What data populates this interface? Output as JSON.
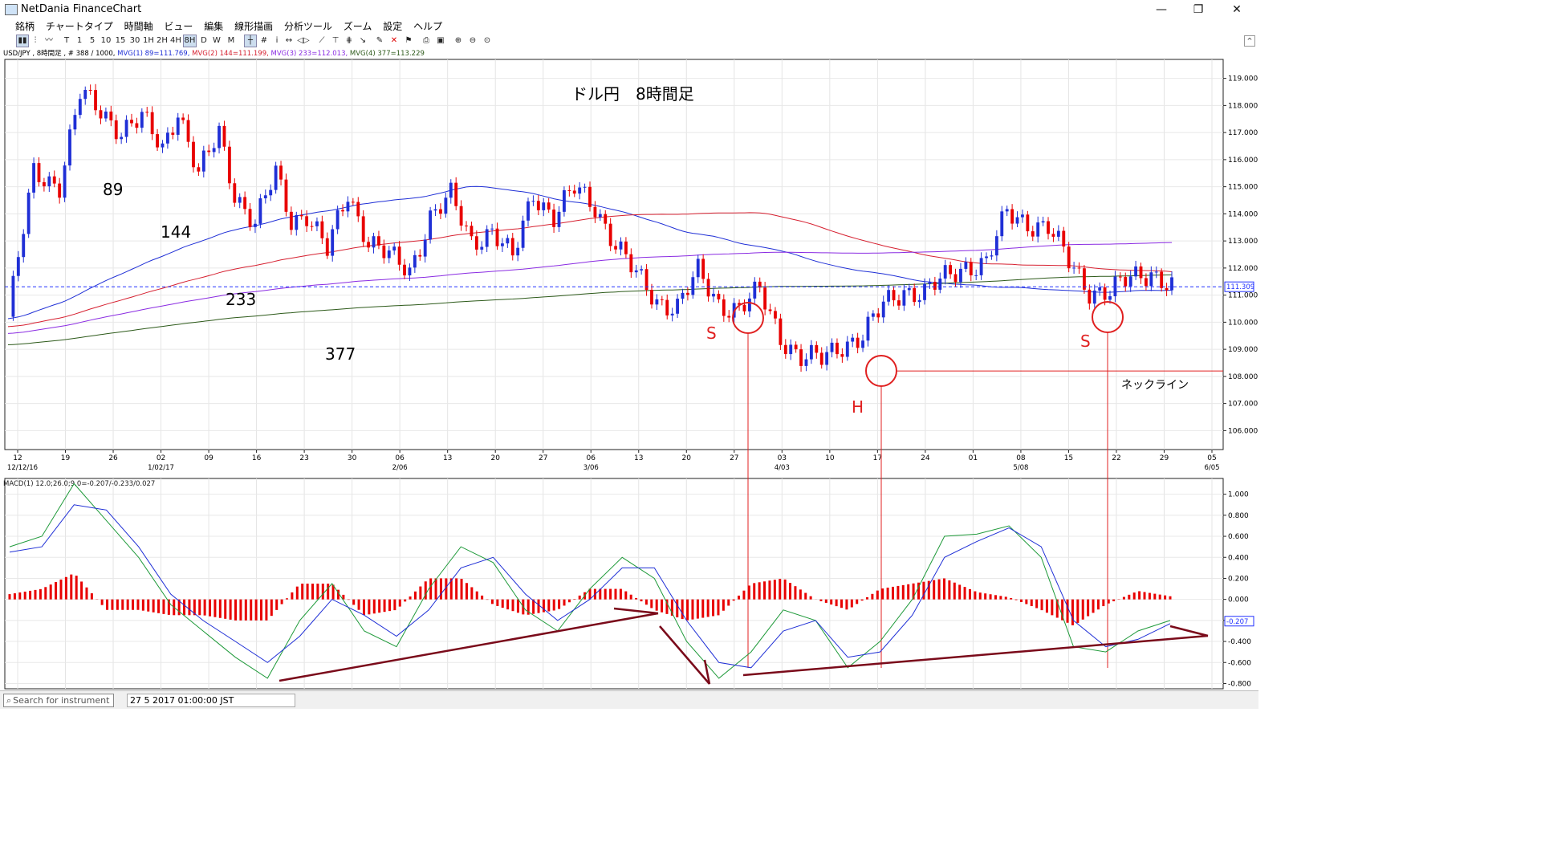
{
  "window": {
    "title": "NetDania FinanceChart",
    "minimize_glyph": "—",
    "maximize_glyph": "❐",
    "close_glyph": "✕"
  },
  "menu": [
    "銘柄",
    "チャートタイプ",
    "時間軸",
    "ビュー",
    "編集",
    "線形描画",
    "分析ツール",
    "ズーム",
    "設定",
    "ヘルプ"
  ],
  "toolbar": {
    "timeframes": [
      "T",
      "1",
      "5",
      "10",
      "15",
      "30",
      "1H",
      "2H",
      "4H",
      "8H",
      "D",
      "W",
      "M"
    ],
    "active_timeframe": "8H",
    "collapse_glyph": "^"
  },
  "infobar": {
    "symbol": "USD/JPY , 8時間足 , # 388 / 1000,",
    "mvg1": "MVG(1) 89=111.769,",
    "mvg2": "MVG(2) 144=111.199,",
    "mvg3": "MVG(3) 233=112.013,",
    "mvg4": "MVG(4) 377=113.229"
  },
  "chart_data": [
    {
      "type": "candlestick",
      "title": "ドル円　8時間足",
      "instrument": "USD/JPY",
      "timeframe": "8時間足",
      "ylim": [
        105.3,
        119.7
      ],
      "yticks": [
        "119.000",
        "118.000",
        "117.000",
        "116.000",
        "115.000",
        "114.000",
        "113.000",
        "112.000",
        "111.000",
        "110.000",
        "109.000",
        "108.000",
        "107.000",
        "106.000"
      ],
      "current_price": "111.309",
      "x_ticks": [
        "12",
        "19",
        "26",
        "02",
        "09",
        "16",
        "23",
        "30",
        "06",
        "13",
        "20",
        "27",
        "06",
        "13",
        "20",
        "27",
        "03",
        "10",
        "17",
        "24",
        "01",
        "08",
        "15",
        "22",
        "29",
        "05"
      ],
      "x_month_labels": [
        "12/12/16",
        "1/02/17",
        "2/06",
        "3/06",
        "4/03",
        "5/08",
        "6/05"
      ],
      "moving_averages": [
        {
          "label": "89",
          "period": 89,
          "color": "#1f2fd6",
          "last": 111.769
        },
        {
          "label": "144",
          "period": 144,
          "color": "#d62030",
          "last": 111.199
        },
        {
          "label": "233",
          "period": 233,
          "color": "#8a2be2",
          "last": 112.013
        },
        {
          "label": "377",
          "period": 377,
          "color": "#2d5a1a",
          "last": 113.229
        }
      ],
      "close_path": [
        [
          0,
          110.2
        ],
        [
          5,
          115.5
        ],
        [
          10,
          115.1
        ],
        [
          14,
          118.4
        ],
        [
          18,
          117.8
        ],
        [
          22,
          117.1
        ],
        [
          26,
          117.5
        ],
        [
          30,
          116.4
        ],
        [
          33,
          117.9
        ],
        [
          37,
          115.4
        ],
        [
          41,
          117.0
        ],
        [
          44,
          114.8
        ],
        [
          48,
          113.6
        ],
        [
          52,
          115.5
        ],
        [
          55,
          113.8
        ],
        [
          58,
          114.0
        ],
        [
          62,
          112.6
        ],
        [
          66,
          114.8
        ],
        [
          70,
          113.0
        ],
        [
          74,
          112.4
        ],
        [
          78,
          111.9
        ],
        [
          82,
          113.9
        ],
        [
          86,
          114.6
        ],
        [
          90,
          113.0
        ],
        [
          94,
          113.4
        ],
        [
          98,
          112.3
        ],
        [
          102,
          114.8
        ],
        [
          106,
          113.9
        ],
        [
          110,
          114.9
        ],
        [
          114,
          114.3
        ],
        [
          118,
          112.9
        ],
        [
          122,
          111.7
        ],
        [
          126,
          110.8
        ],
        [
          130,
          110.6
        ],
        [
          134,
          111.8
        ],
        [
          138,
          110.7
        ],
        [
          142,
          110.5
        ],
        [
          146,
          111.1
        ],
        [
          150,
          109.5
        ],
        [
          154,
          108.7
        ],
        [
          158,
          108.6
        ],
        [
          162,
          109.2
        ],
        [
          166,
          109.5
        ],
        [
          170,
          110.6
        ],
        [
          174,
          111.2
        ],
        [
          178,
          111.1
        ],
        [
          182,
          111.6
        ],
        [
          186,
          112.1
        ],
        [
          190,
          112.2
        ],
        [
          194,
          114.0
        ],
        [
          198,
          113.7
        ],
        [
          202,
          113.5
        ],
        [
          206,
          112.2
        ],
        [
          210,
          111.2
        ],
        [
          214,
          111.1
        ],
        [
          218,
          111.6
        ],
        [
          222,
          111.9
        ],
        [
          226,
          111.3
        ]
      ],
      "annotations": [
        {
          "text": "89"
        },
        {
          "text": "144"
        },
        {
          "text": "233"
        },
        {
          "text": "377"
        },
        {
          "text": "S"
        },
        {
          "text": "H"
        },
        {
          "text": "S"
        },
        {
          "text": "ネックライン"
        }
      ],
      "neckline": 108.2
    },
    {
      "type": "line",
      "title": "MACD(1) 12.0;26.0;9.0=-0.207/-0.233/0.027",
      "ylim": [
        -0.85,
        1.15
      ],
      "yticks": [
        "1.000",
        "0.800",
        "0.600",
        "0.400",
        "0.200",
        "0.000",
        "-0.200",
        "-0.400",
        "-0.600",
        "-0.800"
      ],
      "current_value": "-0.207",
      "series": [
        {
          "name": "MACD",
          "color": "#1f9a3a",
          "values": [
            0.5,
            0.6,
            1.1,
            0.75,
            0.4,
            -0.05,
            -0.3,
            -0.55,
            -0.75,
            -0.2,
            0.15,
            -0.3,
            -0.45,
            0.1,
            0.5,
            0.35,
            -0.1,
            -0.3,
            0.1,
            0.4,
            0.2,
            -0.4,
            -0.75,
            -0.5,
            -0.1,
            -0.2,
            -0.65,
            -0.4,
            0.0,
            0.6,
            0.62,
            0.7,
            0.4,
            -0.45,
            -0.5,
            -0.3,
            -0.2
          ]
        },
        {
          "name": "Signal",
          "color": "#1f2fd6",
          "values": [
            0.45,
            0.5,
            0.9,
            0.85,
            0.5,
            0.05,
            -0.2,
            -0.4,
            -0.6,
            -0.35,
            0.0,
            -0.15,
            -0.35,
            -0.1,
            0.3,
            0.4,
            0.05,
            -0.2,
            0.0,
            0.3,
            0.3,
            -0.2,
            -0.6,
            -0.65,
            -0.3,
            -0.2,
            -0.55,
            -0.5,
            -0.15,
            0.4,
            0.55,
            0.68,
            0.5,
            -0.2,
            -0.45,
            -0.38,
            -0.23
          ]
        },
        {
          "name": "Histogram",
          "color": "#e80000",
          "values": [
            0.05,
            0.1,
            0.25,
            -0.1,
            -0.1,
            -0.15,
            -0.15,
            -0.2,
            -0.2,
            0.15,
            0.15,
            -0.15,
            -0.1,
            0.2,
            0.2,
            -0.05,
            -0.15,
            -0.1,
            0.1,
            0.1,
            -0.1,
            -0.2,
            -0.15,
            0.15,
            0.2,
            0.0,
            -0.1,
            0.1,
            0.15,
            0.2,
            0.07,
            0.02,
            -0.1,
            -0.25,
            -0.05,
            0.08,
            0.03
          ]
        }
      ]
    }
  ],
  "status": {
    "search_placeholder": "Search for instrument",
    "datetime": "27 5 2017 01:00:00 JST"
  }
}
